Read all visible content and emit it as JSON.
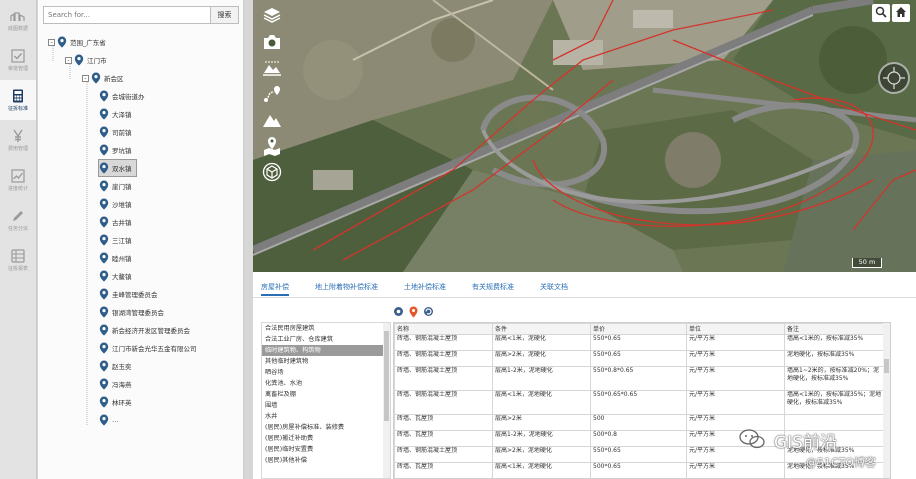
{
  "rail": {
    "items": [
      {
        "label": "底图数据",
        "icon": "city-icon"
      },
      {
        "label": "审批管理",
        "icon": "checkbox-icon"
      },
      {
        "label": "征拆标准",
        "icon": "calculator-icon",
        "active": true
      },
      {
        "label": "费用管理",
        "icon": "yen-icon"
      },
      {
        "label": "进度统计",
        "icon": "chart-icon"
      },
      {
        "label": "任务分派",
        "icon": "pen-icon"
      },
      {
        "label": "征拆报表",
        "icon": "table-icon"
      }
    ]
  },
  "tree": {
    "search_placeholder": "Search for...",
    "search_button": "搜索",
    "nodes": [
      {
        "label": "范围_广东省",
        "level": 0,
        "expander": "-"
      },
      {
        "label": "江门市",
        "level": 1,
        "expander": "-"
      },
      {
        "label": "新会区",
        "level": 2,
        "expander": "-"
      },
      {
        "label": "会城街道办",
        "level": 3
      },
      {
        "label": "大泽镇",
        "level": 3
      },
      {
        "label": "司前镇",
        "level": 3
      },
      {
        "label": "罗坑镇",
        "level": 3
      },
      {
        "label": "双水镇",
        "level": 3,
        "selected": true
      },
      {
        "label": "崖门镇",
        "level": 3
      },
      {
        "label": "沙堆镇",
        "level": 3
      },
      {
        "label": "古井镇",
        "level": 3
      },
      {
        "label": "三江镇",
        "level": 3
      },
      {
        "label": "睦州镇",
        "level": 3
      },
      {
        "label": "大鳌镇",
        "level": 3
      },
      {
        "label": "圭峰管理委员会",
        "level": 3
      },
      {
        "label": "银湖湾管理委员会",
        "level": 3
      },
      {
        "label": "新会经济开发区管理委员会",
        "level": 3
      },
      {
        "label": "江门市新会光华五金有限公司",
        "level": 3
      },
      {
        "label": "赵玉奕",
        "level": 3
      },
      {
        "label": "冯海燕",
        "level": 3
      },
      {
        "label": "林环英",
        "level": 3
      },
      {
        "label": "…",
        "level": 3
      }
    ]
  },
  "map": {
    "scale_label": "50 m",
    "tools": [
      "layers-icon",
      "camera-icon",
      "terrain-grid-icon",
      "route-pin-icon",
      "mountain-icon",
      "map-pin-icon",
      "cube-icon"
    ],
    "colors": {
      "boundary": "#d2352b",
      "highway": "#8a8a8a"
    }
  },
  "tabs": [
    {
      "label": "房屋补偿",
      "active": true
    },
    {
      "label": "地上附着物补偿标准"
    },
    {
      "label": "土地补偿标准"
    },
    {
      "label": "有关规费标准"
    },
    {
      "label": "关联文档"
    }
  ],
  "categories": [
    {
      "label": "合法民用房屋建筑"
    },
    {
      "label": "合法工业厂房、仓库建筑"
    },
    {
      "label": "临时建筑物、构筑物",
      "selected": true
    },
    {
      "label": "其他临时建筑物"
    },
    {
      "label": "晒谷场"
    },
    {
      "label": "化粪池、水池"
    },
    {
      "label": "禽畜栏及棚"
    },
    {
      "label": "围墙"
    },
    {
      "label": "水井"
    },
    {
      "label": "(居民)房屋补偿标准、装修费"
    },
    {
      "label": "(居民)搬迁补助费"
    },
    {
      "label": "(居民)临时安置费"
    },
    {
      "label": "(居民)其他补偿"
    }
  ],
  "table": {
    "columns": [
      "名称",
      "条件",
      "单价",
      "单位",
      "备注"
    ],
    "rows": [
      [
        "砖墙、钢筋混凝土屋顶",
        "层高<1米，泥硬化",
        "550*0.65",
        "元/平方米",
        "墙高<1米的，按标准减35%"
      ],
      [
        "砖墙、钢筋混凝土屋顶",
        "层高>2米，泥硬化",
        "550*0.65",
        "元/平方米",
        "泥地硬化，按标准减35%"
      ],
      [
        "砖墙、钢筋混凝土屋顶",
        "层高1-2米，泥地硬化",
        "550*0.8*0.65",
        "元/平方米",
        "墙高1~2米的，按标准减20%；泥地硬化，按标准减35%"
      ],
      [
        "砖墙、钢筋混凝土屋顶",
        "层高<1米，泥地硬化",
        "550*0.65*0.65",
        "元/平方米",
        "墙高<1米的，按标准减35%；泥地硬化，按标准减35%"
      ],
      [
        "砖墙、瓦屋顶",
        "层高>2米",
        "500",
        "元/平方米",
        ""
      ],
      [
        "砖墙、瓦屋顶",
        "层高1-2米，泥地硬化",
        "500*0.8",
        "元/平方米",
        ""
      ],
      [
        "砖墙、钢筋混凝土屋顶",
        "层高>2米，泥地硬化",
        "550*0.65",
        "元/平方米",
        "泥地硬化，按标准减35%"
      ],
      [
        "砖墙、瓦屋顶",
        "层高<1米，泥地硬化",
        "500*0.65",
        "元/平方米",
        "泥地硬化，按标准减35%"
      ]
    ]
  },
  "watermark": {
    "title": "GIS前沿",
    "subtitle": "@51CTO博客"
  }
}
